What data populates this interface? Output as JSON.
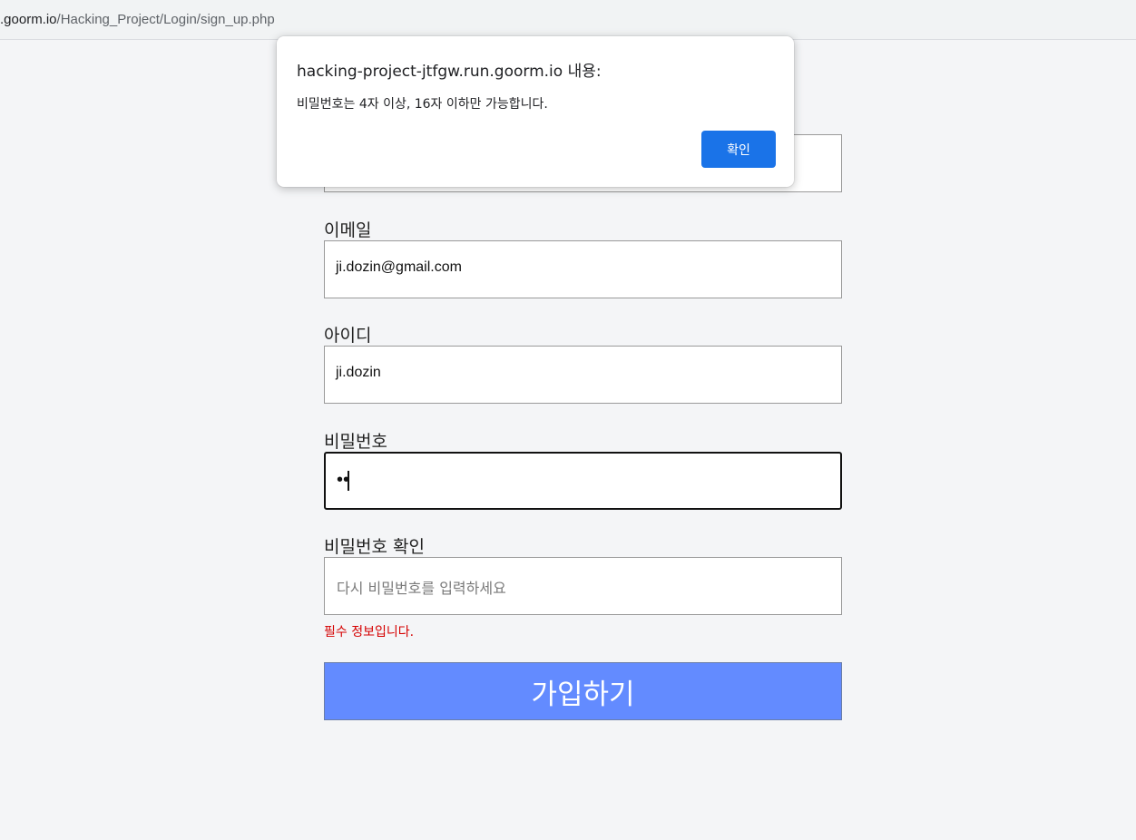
{
  "browser": {
    "url_host": ".goorm.io",
    "url_path": "/Hacking_Project/Login/sign_up.php"
  },
  "form": {
    "email_label": "이메일",
    "email_value": "ji.dozin@gmail.com",
    "id_label": "아이디",
    "id_value": "ji.dozin",
    "password_label": "비밀번호",
    "password_masked": "••",
    "confirm_label": "비밀번호 확인",
    "confirm_placeholder": "다시 비밀번호를 입력하세요",
    "error_message": "필수 정보입니다.",
    "submit_label": "가입하기"
  },
  "dialog": {
    "title": "hacking-project-jtfgw.run.goorm.io 내용:",
    "message": "비밀번호는 4자 이상, 16자 이하만 가능합니다.",
    "ok_label": "확인"
  },
  "colors": {
    "submit_bg": "#638bff",
    "error": "#d50000",
    "dialog_button": "#1a73e8"
  }
}
